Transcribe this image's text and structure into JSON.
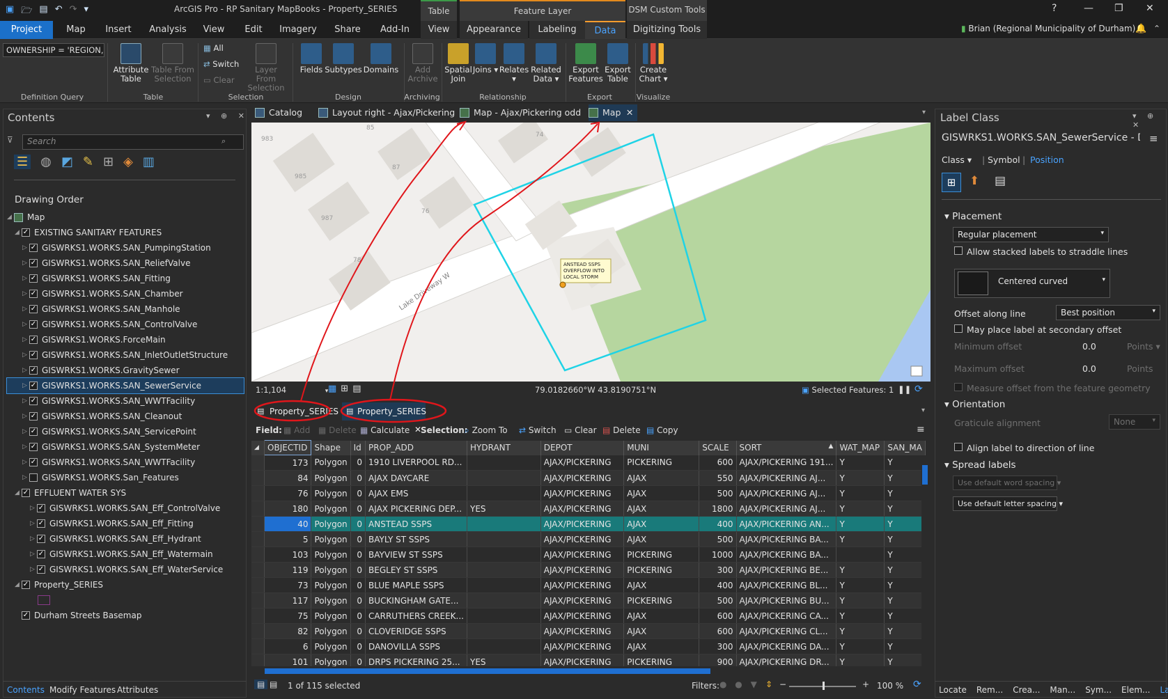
{
  "app": {
    "title": "ArcGIS Pro - RP Sanitary MapBooks - Property_SERIES",
    "user": "Brian (Regional Municipality of Durham)",
    "help": "?"
  },
  "context": {
    "table": "Table",
    "feature_layer": "Feature Layer",
    "dsm": "DSM Custom Tools"
  },
  "tabs": [
    "Project",
    "Map",
    "Insert",
    "Analysis",
    "View",
    "Edit",
    "Imagery",
    "Share",
    "Add-In",
    "View",
    "Appearance",
    "Labeling",
    "Data",
    "Digitizing Tools"
  ],
  "ribbon": {
    "def_query": "OWNERSHIP = 'REGION,",
    "groups": {
      "definition_query": "Definition Query",
      "table": "Table",
      "selection": "Selection",
      "design": "Design",
      "archiving": "Archiving",
      "relationship": "Relationship",
      "export": "Export",
      "visualize": "Visualize"
    },
    "attribute_table": "Attribute Table",
    "table_from_selection": "Table From Selection",
    "all": "All",
    "switch": "Switch",
    "clear": "Clear",
    "layer_from_selection": "Layer From Selection",
    "fields": "Fields",
    "subtypes": "Subtypes",
    "domains": "Domains",
    "add_archive": "Add Archive",
    "spatial_join": "Spatial Join",
    "joins": "Joins",
    "relates": "Relates",
    "related_data": "Related Data",
    "export_features": "Export Features",
    "export_table": "Export Table",
    "create_chart": "Create Chart"
  },
  "contents": {
    "title": "Contents",
    "search_placeholder": "Search",
    "drawing_order": "Drawing Order",
    "items": [
      {
        "label": "Map",
        "level": 0,
        "check": "none",
        "arrow": "open",
        "kind": "map"
      },
      {
        "label": "EXISTING SANITARY FEATURES",
        "level": 1,
        "check": "on",
        "arrow": "open"
      },
      {
        "label": "GISWRKS1.WORKS.SAN_PumpingStation",
        "level": 2,
        "check": "on",
        "arrow": "closed"
      },
      {
        "label": "GISWRKS1.WORKS.SAN_ReliefValve",
        "level": 2,
        "check": "on",
        "arrow": "closed"
      },
      {
        "label": "GISWRKS1.WORKS.SAN_Fitting",
        "level": 2,
        "check": "on",
        "arrow": "closed"
      },
      {
        "label": "GISWRKS1.WORKS.SAN_Chamber",
        "level": 2,
        "check": "on",
        "arrow": "closed"
      },
      {
        "label": "GISWRKS1.WORKS.SAN_Manhole",
        "level": 2,
        "check": "on",
        "arrow": "closed"
      },
      {
        "label": "GISWRKS1.WORKS.SAN_ControlValve",
        "level": 2,
        "check": "on",
        "arrow": "closed"
      },
      {
        "label": "GISWRKS1.WORKS.ForceMain",
        "level": 2,
        "check": "on",
        "arrow": "closed"
      },
      {
        "label": "GISWRKS1.WORKS.SAN_InletOutletStructure",
        "level": 2,
        "check": "on",
        "arrow": "closed"
      },
      {
        "label": "GISWRKS1.WORKS.GravitySewer",
        "level": 2,
        "check": "on",
        "arrow": "closed"
      },
      {
        "label": "GISWRKS1.WORKS.SAN_SewerService",
        "level": 2,
        "check": "on",
        "arrow": "closed",
        "selected": true
      },
      {
        "label": "GISWRKS1.WORKS.SAN_WWTFacility",
        "level": 2,
        "check": "on",
        "arrow": "closed"
      },
      {
        "label": "GISWRKS1.WORKS.SAN_Cleanout",
        "level": 2,
        "check": "on",
        "arrow": "closed"
      },
      {
        "label": "GISWRKS1.WORKS.SAN_ServicePoint",
        "level": 2,
        "check": "on",
        "arrow": "closed"
      },
      {
        "label": "GISWRKS1.WORKS.SAN_SystemMeter",
        "level": 2,
        "check": "on",
        "arrow": "closed"
      },
      {
        "label": "GISWRKS1.WORKS.SAN_WWTFacility",
        "level": 2,
        "check": "on",
        "arrow": "closed"
      },
      {
        "label": "GISWRKS1.WORKS.San_Features",
        "level": 2,
        "check": "off",
        "arrow": "closed"
      },
      {
        "label": "EFFLUENT WATER SYS",
        "level": 1,
        "check": "on",
        "arrow": "open"
      },
      {
        "label": "GISWRKS1.WORKS.SAN_Eff_ControlValve",
        "level": 3,
        "check": "on",
        "arrow": "closed"
      },
      {
        "label": "GISWRKS1.WORKS.SAN_Eff_Fitting",
        "level": 3,
        "check": "on",
        "arrow": "closed"
      },
      {
        "label": "GISWRKS1.WORKS.SAN_Eff_Hydrant",
        "level": 3,
        "check": "on",
        "arrow": "closed"
      },
      {
        "label": "GISWRKS1.WORKS.SAN_Eff_Watermain",
        "level": 3,
        "check": "on",
        "arrow": "closed"
      },
      {
        "label": "GISWRKS1.WORKS.SAN_Eff_WaterService",
        "level": 3,
        "check": "on",
        "arrow": "closed"
      },
      {
        "label": "Property_SERIES",
        "level": 1,
        "check": "on",
        "arrow": "open"
      },
      {
        "label": "",
        "level": 2,
        "check": "none",
        "arrow": "none",
        "kind": "swatch"
      },
      {
        "label": "Durham Streets Basemap",
        "level": 1,
        "check": "on",
        "arrow": "none"
      }
    ],
    "bottom_tabs": [
      "Contents",
      "Modify Features",
      "Attributes"
    ]
  },
  "views": {
    "tabs": [
      "Catalog",
      "Layout right - Ajax/Pickering",
      "Map - Ajax/Pickering odd",
      "Map"
    ]
  },
  "map": {
    "labels": {
      "n983": "983",
      "n985": "985",
      "n987": "987",
      "n85": "85",
      "n87": "87",
      "n74": "74",
      "n76": "76",
      "n78": "78",
      "street": "Lake Driveway W"
    },
    "callout": "ANSTEAD SSPS OVERFLOW INTO LOCAL STORM",
    "scale": "1:1,104",
    "coords": "79.0182660°W 43.8190751°N",
    "selected_features": "Selected Features: 1"
  },
  "attr": {
    "tabs": [
      "Property_SERIES",
      "Property_SERIES"
    ],
    "field_label": "Field:",
    "add": "Add",
    "delete": "Delete",
    "calculate": "Calculate",
    "selection_label": "Selection:",
    "zoom_to": "Zoom To",
    "switch": "Switch",
    "clear": "Clear",
    "sel_delete": "Delete",
    "copy": "Copy",
    "columns": [
      "OBJECTID",
      "Shape",
      "Id",
      "PROP_ADD",
      "HYDRANT",
      "DEPOT",
      "MUNI",
      "SCALE",
      "SORT",
      "WAT_MAP",
      "SAN_MA"
    ],
    "rows": [
      [
        "173",
        "Polygon",
        "0",
        "1910 LIVERPOOL RD...",
        "",
        "AJAX/PICKERING",
        "PICKERING",
        "600",
        "AJAX/PICKERING 191...",
        "Y",
        "Y"
      ],
      [
        "84",
        "Polygon",
        "0",
        "AJAX DAYCARE",
        "",
        "AJAX/PICKERING",
        "AJAX",
        "550",
        "AJAX/PICKERING AJ...",
        "Y",
        "Y"
      ],
      [
        "76",
        "Polygon",
        "0",
        "AJAX EMS",
        "",
        "AJAX/PICKERING",
        "AJAX",
        "500",
        "AJAX/PICKERING AJ...",
        "Y",
        "Y"
      ],
      [
        "180",
        "Polygon",
        "0",
        "AJAX PICKERING DEP...",
        "YES",
        "AJAX/PICKERING",
        "AJAX",
        "1800",
        "AJAX/PICKERING AJ...",
        "Y",
        "Y"
      ],
      [
        "40",
        "Polygon",
        "0",
        "ANSTEAD SSPS",
        "",
        "AJAX/PICKERING",
        "AJAX",
        "400",
        "AJAX/PICKERING AN...",
        "Y",
        "Y"
      ],
      [
        "5",
        "Polygon",
        "0",
        "BAYLY ST SSPS",
        "",
        "AJAX/PICKERING",
        "AJAX",
        "500",
        "AJAX/PICKERING BA...",
        "Y",
        "Y"
      ],
      [
        "103",
        "Polygon",
        "0",
        "BAYVIEW ST SSPS",
        "",
        "AJAX/PICKERING",
        "PICKERING",
        "1000",
        "AJAX/PICKERING BA...",
        "",
        "Y"
      ],
      [
        "119",
        "Polygon",
        "0",
        "BEGLEY ST SSPS",
        "",
        "AJAX/PICKERING",
        "PICKERING",
        "300",
        "AJAX/PICKERING BE...",
        "Y",
        "Y"
      ],
      [
        "73",
        "Polygon",
        "0",
        "BLUE MAPLE SSPS",
        "",
        "AJAX/PICKERING",
        "AJAX",
        "400",
        "AJAX/PICKERING BL...",
        "Y",
        "Y"
      ],
      [
        "117",
        "Polygon",
        "0",
        "BUCKINGHAM GATE...",
        "",
        "AJAX/PICKERING",
        "PICKERING",
        "500",
        "AJAX/PICKERING BU...",
        "Y",
        "Y"
      ],
      [
        "75",
        "Polygon",
        "0",
        "CARRUTHERS CREEK...",
        "",
        "AJAX/PICKERING",
        "AJAX",
        "600",
        "AJAX/PICKERING CA...",
        "Y",
        "Y"
      ],
      [
        "82",
        "Polygon",
        "0",
        "CLOVERIDGE SSPS",
        "",
        "AJAX/PICKERING",
        "AJAX",
        "600",
        "AJAX/PICKERING CL...",
        "Y",
        "Y"
      ],
      [
        "6",
        "Polygon",
        "0",
        "DANOVILLA SSPS",
        "",
        "AJAX/PICKERING",
        "AJAX",
        "300",
        "AJAX/PICKERING DA...",
        "Y",
        "Y"
      ],
      [
        "101",
        "Polygon",
        "0",
        "DRPS PICKERING 25...",
        "YES",
        "AJAX/PICKERING",
        "PICKERING",
        "900",
        "AJAX/PICKERING DR...",
        "Y",
        "Y"
      ]
    ],
    "selected_row": 4,
    "status": "1 of 115 selected",
    "filters": "Filters:",
    "zoom": "100 %"
  },
  "label_class": {
    "title": "Label Class",
    "layer": "GISWRKS1.WORKS.SAN_SewerService - D...",
    "tabs": [
      "Class",
      "Symbol",
      "Position"
    ],
    "placement": "Placement",
    "placement_value": "Regular placement",
    "allow_stacked": "Allow stacked labels to straddle lines",
    "curve": "Centered curved",
    "offset_along": "Offset along line",
    "offset_value": "Best position",
    "secondary": "May place label at secondary offset",
    "min_offset": "Minimum offset",
    "max_offset": "Maximum offset",
    "min_val": "0.0",
    "max_val": "0.0",
    "points": "Points",
    "measure": "Measure offset from the feature geometry",
    "orientation": "Orientation",
    "graticule": "Graticule alignment",
    "none": "None",
    "align": "Align label to direction of line",
    "spread": "Spread labels",
    "word": "Use default word spacing",
    "letter": "Use default letter spacing",
    "bottom_tabs": [
      "Locate",
      "Rem...",
      "Crea...",
      "Man...",
      "Sym...",
      "Elem...",
      "Labe..."
    ]
  },
  "colors": {
    "accent": "#4aa3ff",
    "highlight": "#197a7a",
    "annotation": "#e0161b",
    "selection_outline": "#1fd3e6",
    "park": "#b6d69f",
    "water": "#a9c7f2"
  }
}
